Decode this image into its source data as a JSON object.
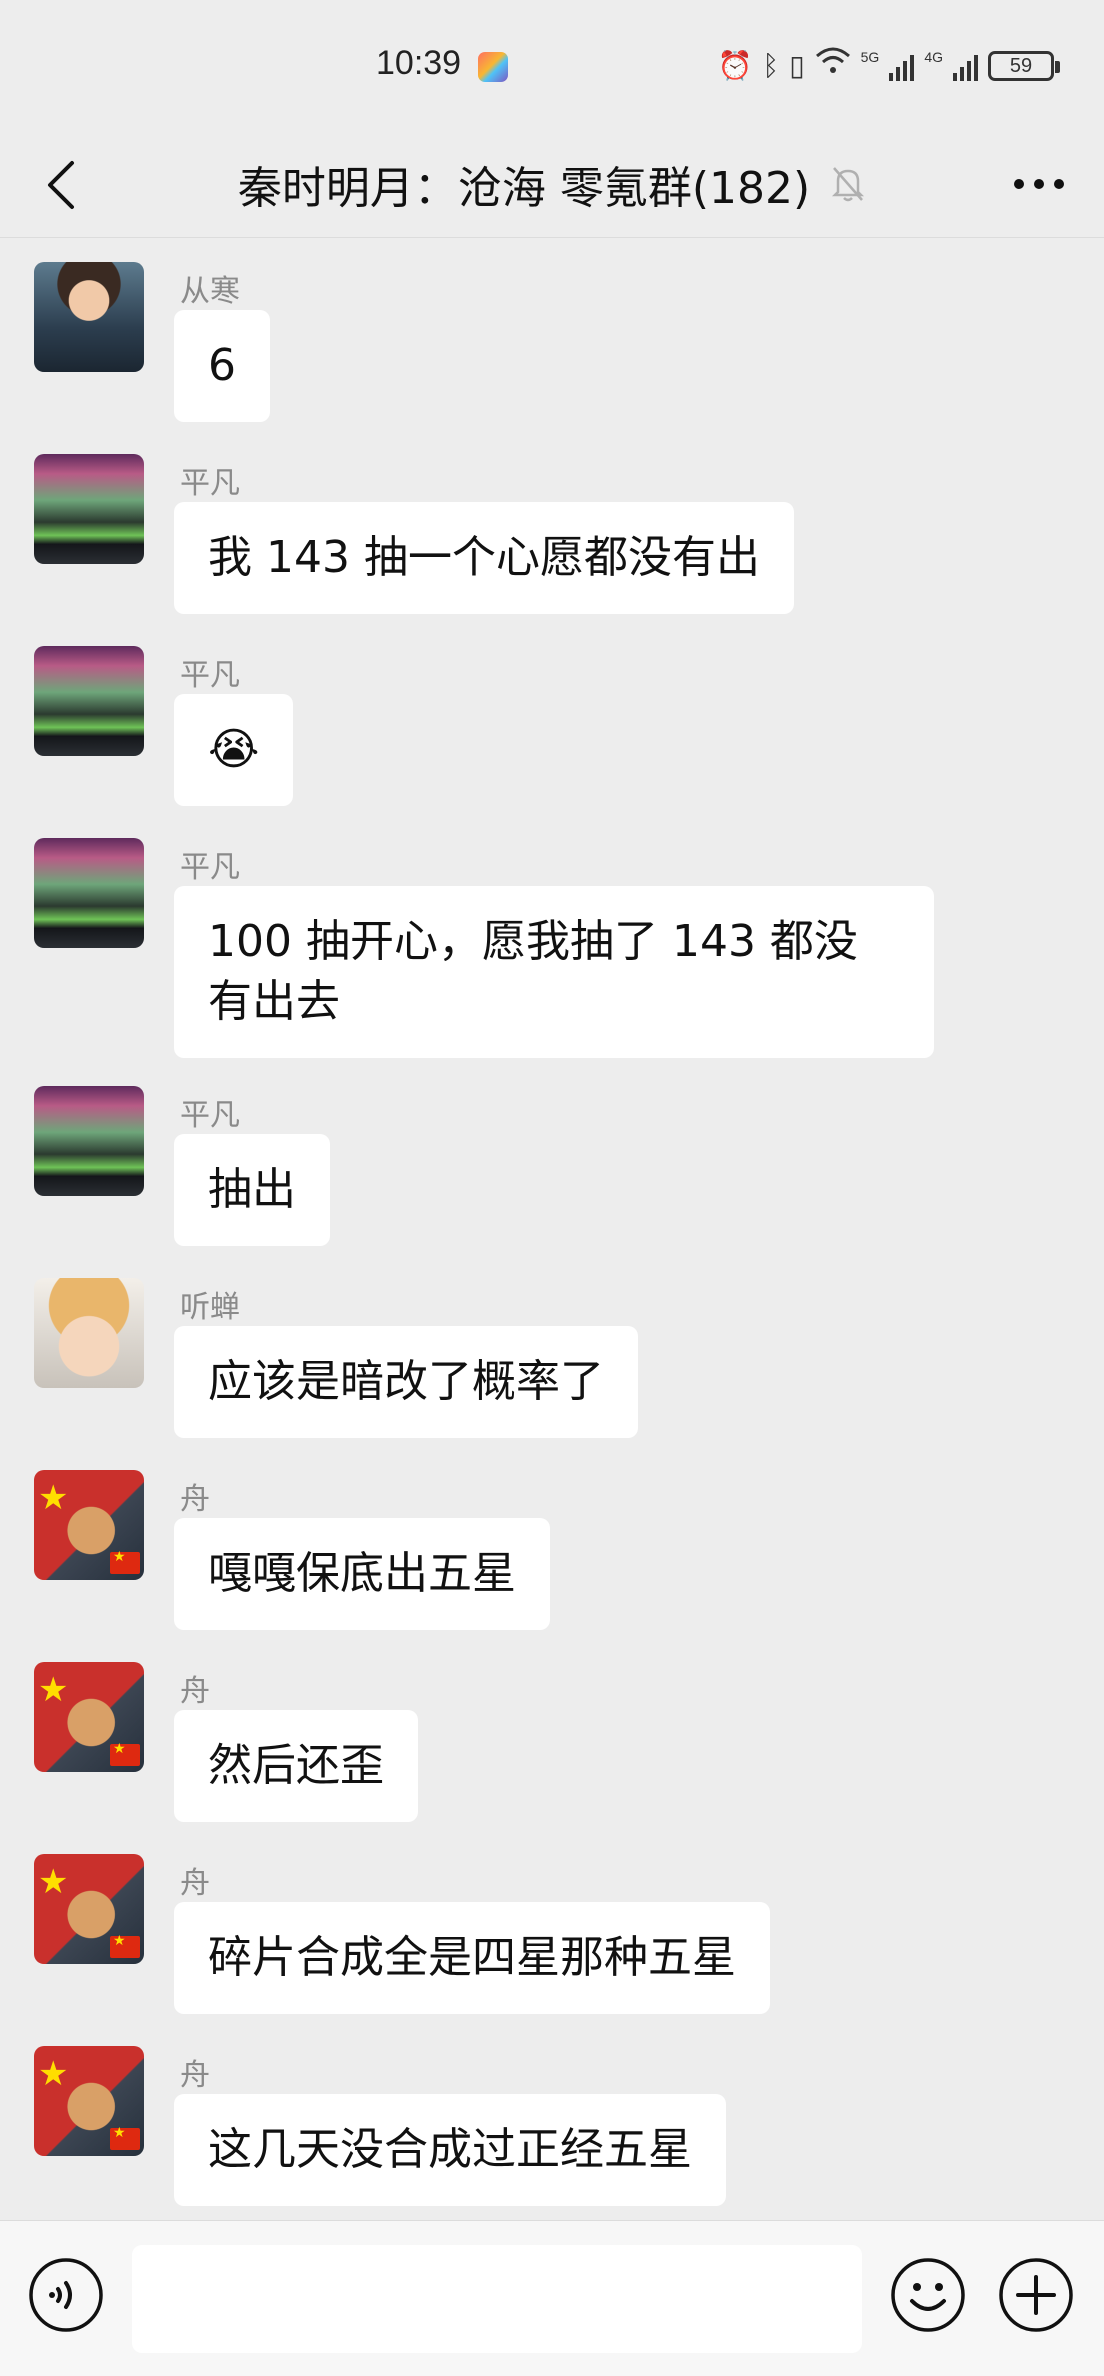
{
  "status_bar": {
    "time": "10:39",
    "net1": "5G",
    "net2": "4G",
    "battery": "59"
  },
  "header": {
    "title": "秦时明月：沧海 零氪群(182)"
  },
  "messages": [
    {
      "sender": "从寒",
      "text": "6",
      "avatar": "man-with-cat"
    },
    {
      "sender": "平凡",
      "text": "我 143 抽一个心愿都没有出",
      "avatar": "aurora"
    },
    {
      "sender": "平凡",
      "text": "😭",
      "avatar": "aurora"
    },
    {
      "sender": "平凡",
      "text": "100 抽开心，愿我抽了 143 都没有出去",
      "avatar": "aurora"
    },
    {
      "sender": "平凡",
      "text": "抽出",
      "avatar": "aurora"
    },
    {
      "sender": "听蝉",
      "text": "应该是暗改了概率了",
      "avatar": "baby"
    },
    {
      "sender": "舟",
      "text": "嘎嘎保底出五星",
      "avatar": "cat-flag"
    },
    {
      "sender": "舟",
      "text": "然后还歪",
      "avatar": "cat-flag"
    },
    {
      "sender": "舟",
      "text": "碎片合成全是四星那种五星",
      "avatar": "cat-flag"
    },
    {
      "sender": "舟",
      "text": "这几天没合成过正经五星",
      "avatar": "cat-flag"
    }
  ],
  "input": {
    "value": "",
    "placeholder": ""
  },
  "icons": {
    "back": "back-arrow-icon",
    "mute": "mute-bell-icon",
    "more": "more-icon",
    "voice": "voice-icon",
    "emoji": "emoji-icon",
    "plus": "plus-icon"
  }
}
